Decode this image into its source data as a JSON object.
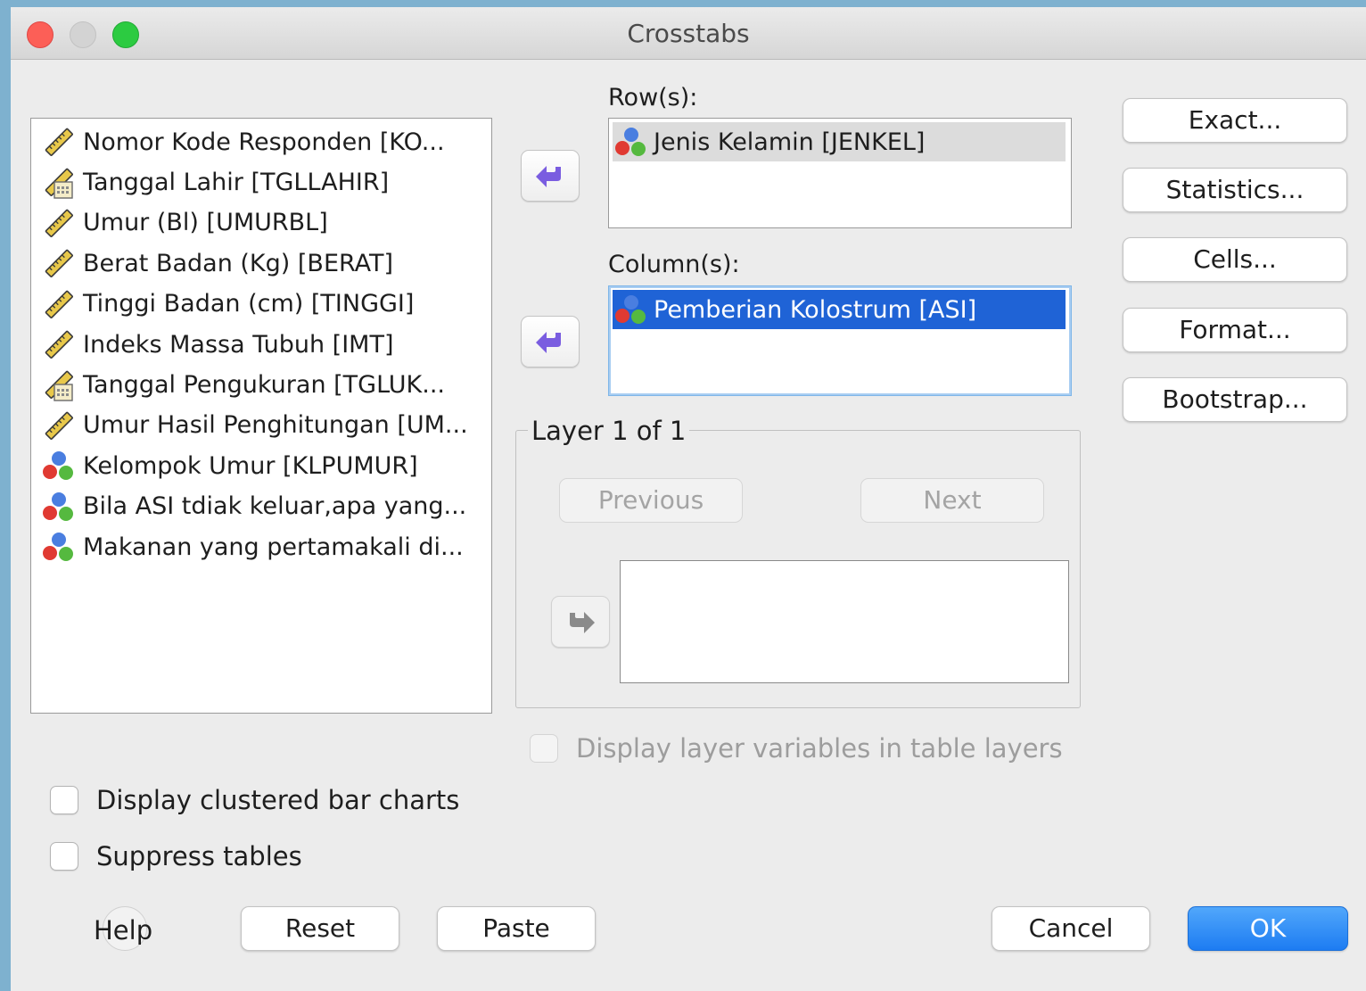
{
  "window": {
    "title": "Crosstabs"
  },
  "variables": [
    {
      "label": "Nomor Kode Responden [KO...",
      "icon": "ruler-scale-icon"
    },
    {
      "label": "Tanggal Lahir [TGLLAHIR]",
      "icon": "calendar-scale-icon"
    },
    {
      "label": "Umur (Bl) [UMURBL]",
      "icon": "ruler-scale-icon"
    },
    {
      "label": "Berat Badan (Kg) [BERAT]",
      "icon": "ruler-scale-icon"
    },
    {
      "label": "Tinggi Badan (cm) [TINGGI]",
      "icon": "ruler-scale-icon"
    },
    {
      "label": "Indeks Massa Tubuh [IMT]",
      "icon": "ruler-scale-icon"
    },
    {
      "label": "Tanggal Pengukuran [TGLUK...",
      "icon": "calendar-scale-icon"
    },
    {
      "label": "Umur Hasil Penghitungan [UM...",
      "icon": "ruler-scale-icon"
    },
    {
      "label": "Kelompok Umur [KLPUMUR]",
      "icon": "nominal-balls-icon"
    },
    {
      "label": "Bila ASI tdiak keluar,apa yang...",
      "icon": "nominal-balls-icon"
    },
    {
      "label": "Makanan yang pertamakali di...",
      "icon": "nominal-balls-icon"
    }
  ],
  "rows": {
    "label": "Row(s):",
    "items": [
      "Jenis Kelamin [JENKEL]"
    ]
  },
  "columns": {
    "label": "Column(s):",
    "items": [
      "Pemberian Kolostrum [ASI]"
    ]
  },
  "layer": {
    "title": "Layer 1 of 1",
    "previous": "Previous",
    "next": "Next"
  },
  "side_buttons": {
    "exact": "Exact...",
    "statistics": "Statistics...",
    "cells": "Cells...",
    "format": "Format...",
    "bootstrap": "Bootstrap..."
  },
  "options": {
    "display_layer": "Display layer variables in table layers",
    "clustered_bar": "Display clustered bar charts",
    "suppress": "Suppress tables"
  },
  "footer": {
    "help": "Help",
    "reset": "Reset",
    "paste": "Paste",
    "cancel": "Cancel",
    "ok": "OK"
  },
  "colors": {
    "selection_blue": "#1f63d6",
    "ok_blue": "#1d7cf2",
    "arrow_purple": "#7a5de0"
  }
}
